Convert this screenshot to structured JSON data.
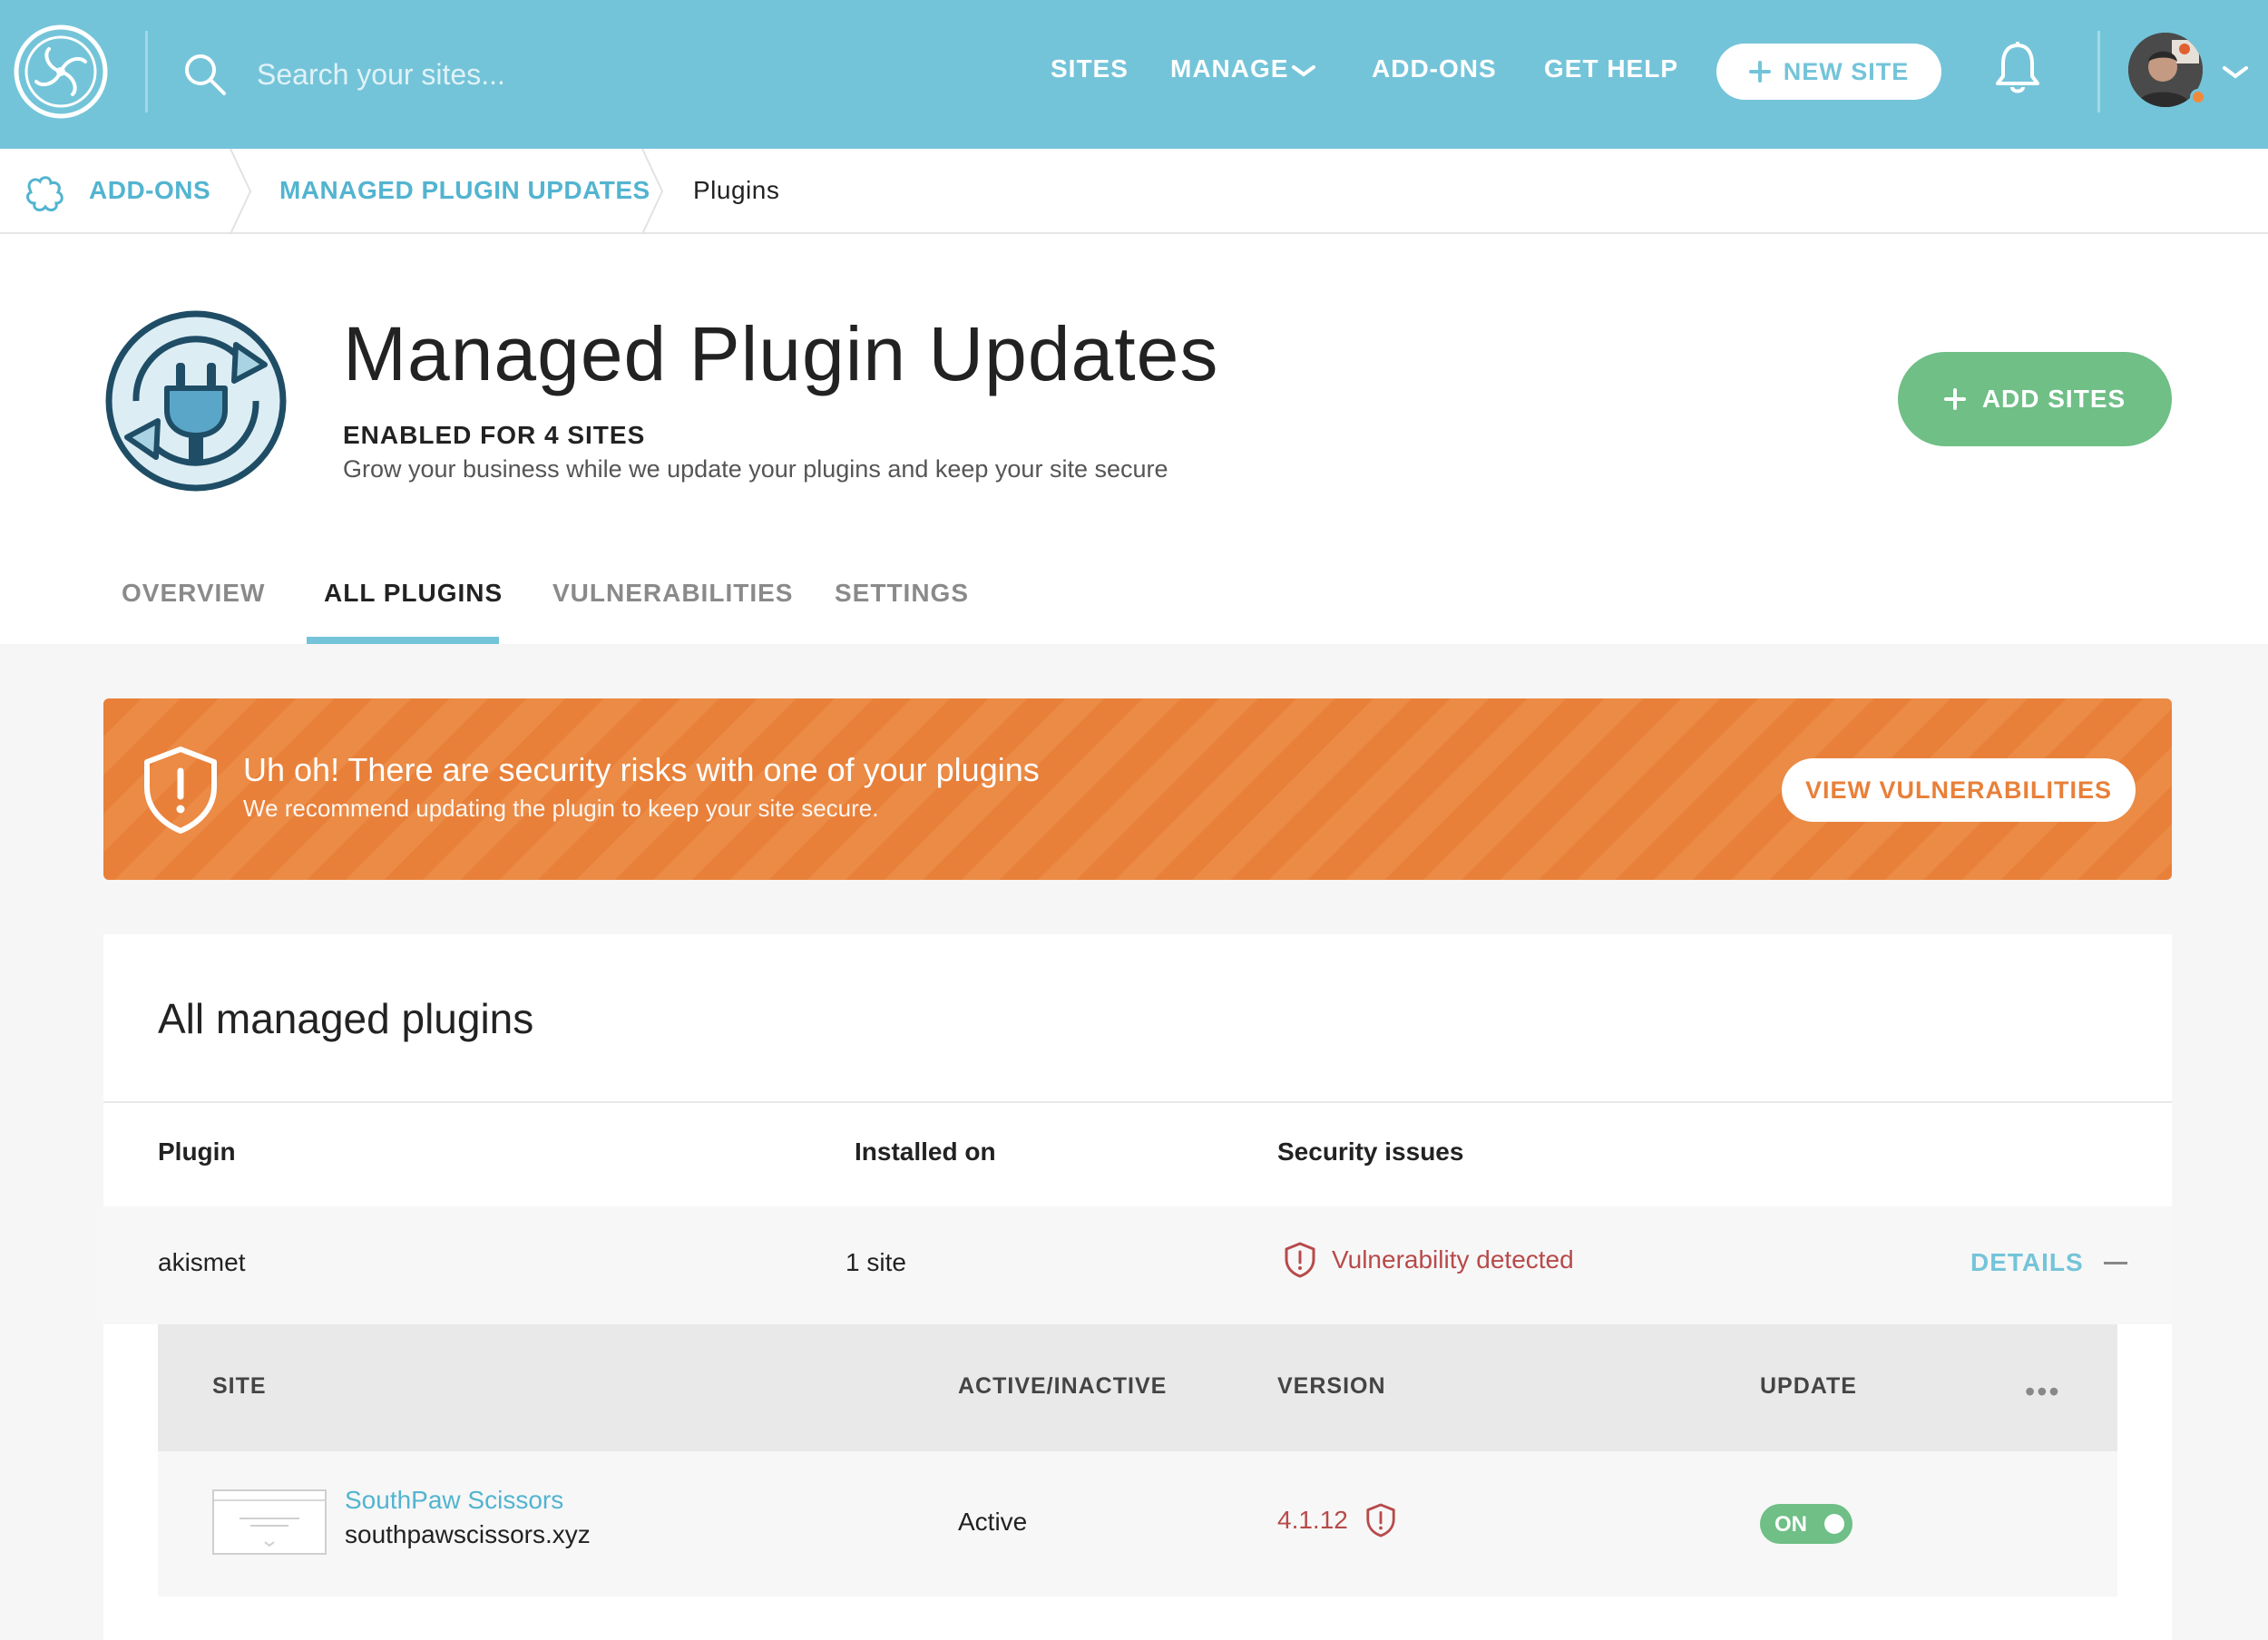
{
  "topbar": {
    "search_placeholder": "Search your sites...",
    "nav": {
      "sites": "SITES",
      "manage": "MANAGE",
      "addons": "ADD-ONS",
      "get_help": "GET HELP"
    },
    "new_site_label": "NEW SITE",
    "new_site_icon": "plus-icon",
    "bell_icon": "bell-icon",
    "accent": "#74c4d9"
  },
  "breadcrumb": {
    "items": [
      "ADD-ONS",
      "MANAGED PLUGIN UPDATES",
      "Plugins"
    ]
  },
  "header": {
    "title": "Managed Plugin Updates",
    "enabled": "ENABLED FOR 4 SITES",
    "subtitle": "Grow your business while we update your plugins and keep your site secure",
    "add_sites_label": "ADD SITES",
    "add_sites_color": "#6fbf86",
    "tabs": [
      "OVERVIEW",
      "ALL PLUGINS",
      "VULNERABILITIES",
      "SETTINGS"
    ],
    "active_tab": "ALL PLUGINS"
  },
  "alert": {
    "title": "Uh oh! There are security risks with one of your plugins",
    "subtitle": "We recommend updating the plugin to keep your site secure.",
    "button_label": "VIEW VULNERABILITIES",
    "color": "#e8803a"
  },
  "plugins_card": {
    "title": "All managed plugins",
    "columns": [
      "Plugin",
      "Installed on",
      "Security issues"
    ],
    "rows": [
      {
        "plugin": "akismet",
        "installed_on": "1 site",
        "security": "Vulnerability detected",
        "details_label": "DETAILS",
        "sites_table": {
          "columns": [
            "SITE",
            "ACTIVE/INACTIVE",
            "VERSION",
            "UPDATE"
          ],
          "more_label": "•••",
          "rows": [
            {
              "site_name": "SouthPaw Scissors",
              "site_url": "southpawscissors.xyz",
              "status": "Active",
              "version": "4.1.12",
              "update_toggle": "ON"
            }
          ]
        }
      }
    ]
  }
}
